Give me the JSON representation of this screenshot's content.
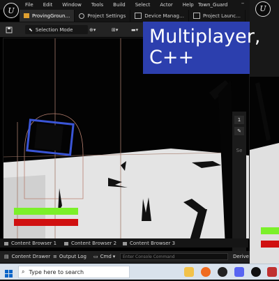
{
  "menubar": {
    "items": [
      "File",
      "Edit",
      "Window",
      "Tools",
      "Build",
      "Select",
      "Actor",
      "Help"
    ],
    "window_title": "Town_Guard"
  },
  "tabs": [
    {
      "label": "ProvingGroun…",
      "active": true
    },
    {
      "label": "Project Settings",
      "active": false
    },
    {
      "label": "Device Manag…",
      "active": false
    },
    {
      "label": "Project Launc…",
      "active": false
    }
  ],
  "toolbar": {
    "mode_label": "Selection Mode"
  },
  "overlay": {
    "line1": "Multiplayer,",
    "line2": "C++"
  },
  "right_panel": {
    "button_1": "1"
  },
  "content_browser": {
    "tabs": [
      "Content Browser 1",
      "Content Browser 2",
      "Content Browser 3"
    ]
  },
  "statusbar": {
    "drawer": "Content Drawer",
    "output_log": "Output Log",
    "cmd": "Cmd",
    "console_placeholder": "Enter Console Command",
    "derive": "Derive"
  },
  "taskbar": {
    "search_placeholder": "Type here to search"
  },
  "colors": {
    "health_green": "#7bf02a",
    "health_red": "#d01010",
    "overlay_blue": "#2c3fae"
  }
}
